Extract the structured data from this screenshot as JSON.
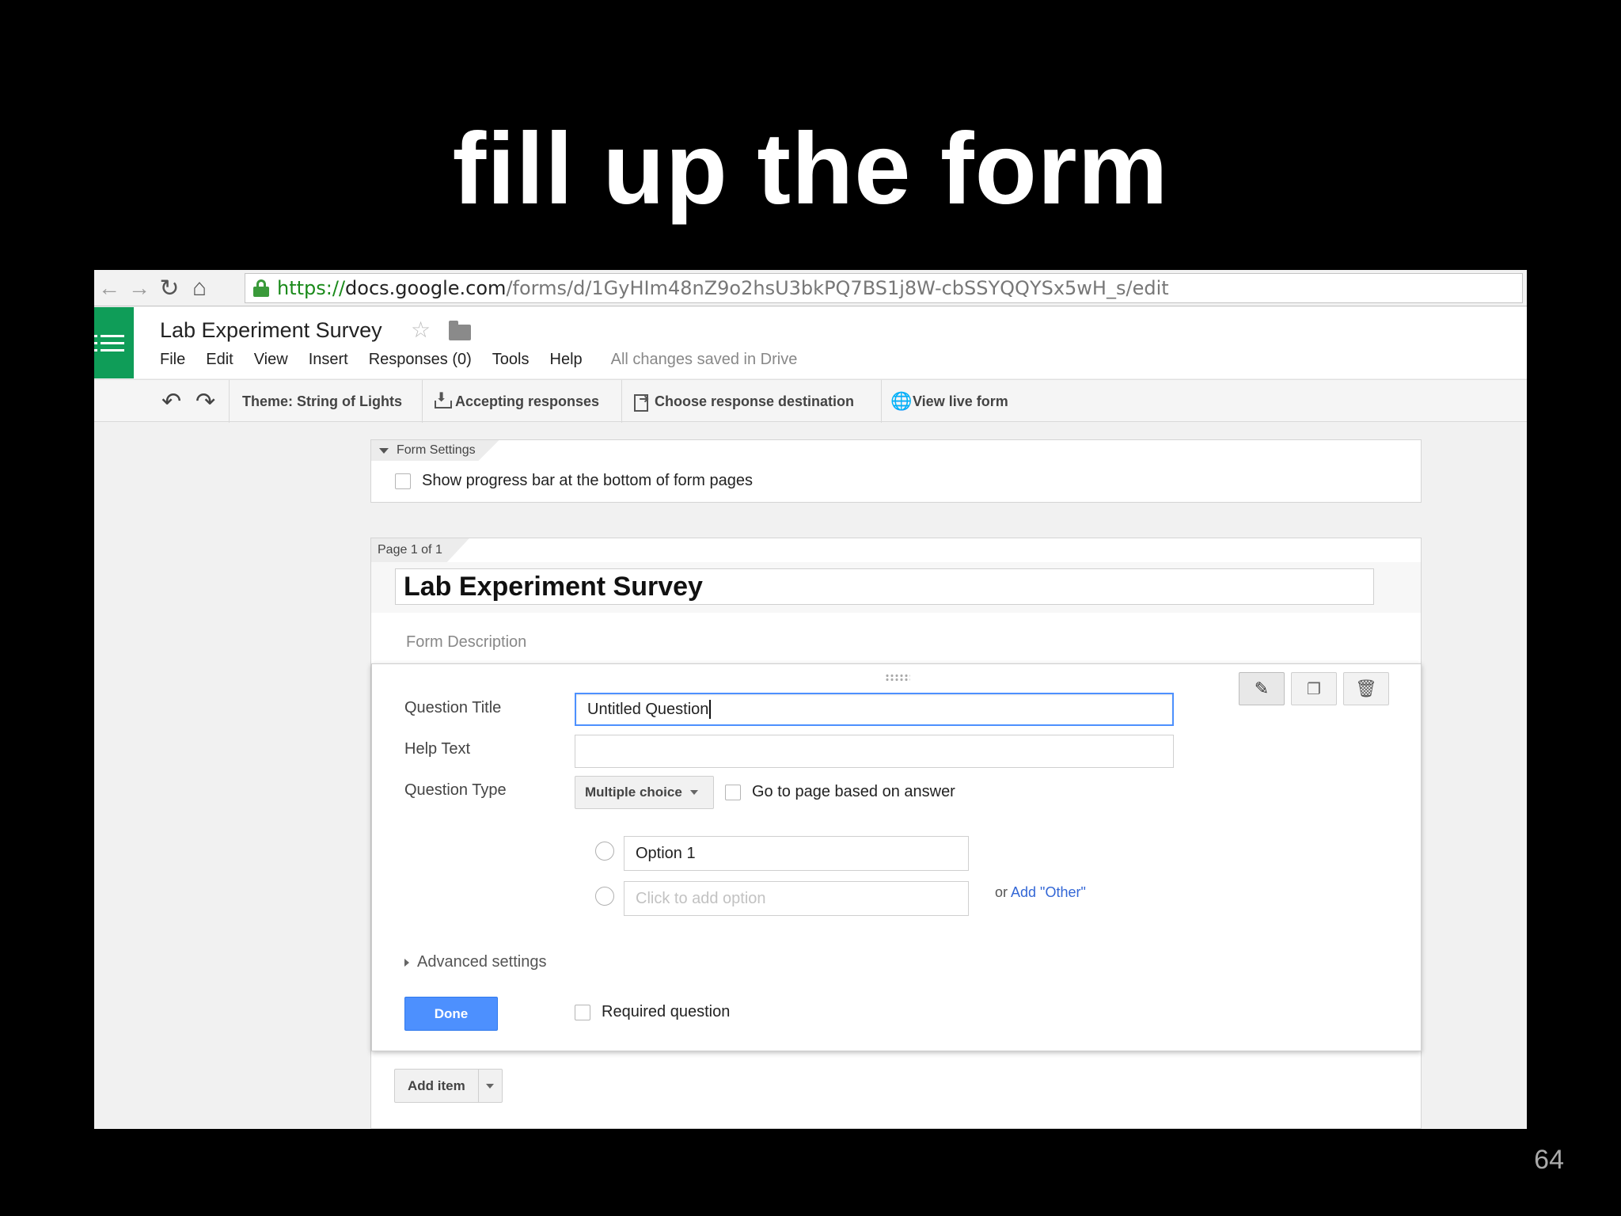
{
  "slide": {
    "title": "fill up the form",
    "number": "64"
  },
  "browser": {
    "url_scheme": "https://",
    "url_host": "docs.google.com",
    "url_path": "/forms/d/1GyHIm48nZ9o2hsU3bkPQ7BS1j8W-cbSSYQQYSx5wH_s/edit",
    "back_icon": "arrow-left-icon",
    "forward_icon": "arrow-right-icon",
    "reload_icon": "reload-icon",
    "home_icon": "home-icon"
  },
  "app": {
    "doc_title": "Lab Experiment Survey",
    "menu": [
      "File",
      "Edit",
      "View",
      "Insert",
      "Responses (0)",
      "Tools",
      "Help"
    ],
    "save_status": "All changes saved in Drive",
    "accent_color": "#0f9d58"
  },
  "toolbar": {
    "theme": "Theme: String of Lights",
    "accepting": "Accepting responses",
    "destination": "Choose response destination",
    "live_form": "View live form"
  },
  "form_settings": {
    "tab": "Form Settings",
    "progress_bar_label": "Show progress bar at the bottom of form pages",
    "progress_bar_checked": false
  },
  "page": {
    "tab": "Page 1 of 1",
    "form_title": "Lab Experiment Survey",
    "form_description_placeholder": "Form Description"
  },
  "question": {
    "title_label": "Question Title",
    "title_value": "Untitled Question",
    "help_label": "Help Text",
    "help_value": "",
    "type_label": "Question Type",
    "type_value": "Multiple choice",
    "goto_label": "Go to page based on answer",
    "options": [
      "Option 1"
    ],
    "add_option_placeholder": "Click to add option",
    "or_text": "or",
    "add_other": "Add \"Other\"",
    "advanced": "Advanced settings",
    "done": "Done",
    "required_label": "Required question",
    "actions": [
      "pencil-icon",
      "duplicate-icon",
      "trash-icon"
    ]
  },
  "add_item": {
    "label": "Add item"
  }
}
